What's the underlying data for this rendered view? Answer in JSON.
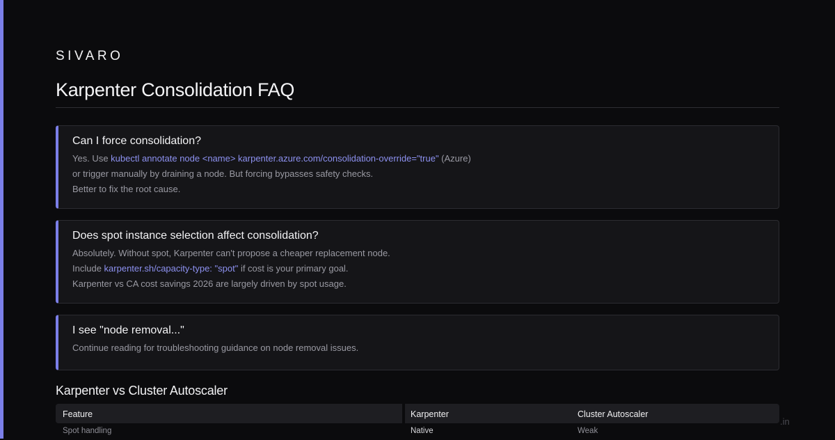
{
  "brand": "SIVARO",
  "page_title": "Karpenter Consolidation FAQ",
  "faq": [
    {
      "question": "Can I force consolidation?",
      "lines": [
        [
          {
            "text": "Yes. Use ",
            "code": false
          },
          {
            "text": "kubectl annotate node <name> karpenter.azure.com/consolidation-override=\"true\"",
            "code": true
          },
          {
            "text": " (Azure)",
            "code": false
          }
        ],
        [
          {
            "text": "or trigger manually by draining a node. But forcing bypasses safety checks.",
            "code": false
          }
        ],
        [
          {
            "text": "Better to fix the root cause.",
            "code": false
          }
        ]
      ]
    },
    {
      "question": "Does spot instance selection affect consolidation?",
      "lines": [
        [
          {
            "text": "Absolutely. Without spot, Karpenter can't propose a cheaper replacement node.",
            "code": false
          }
        ],
        [
          {
            "text": "Include ",
            "code": false
          },
          {
            "text": "karpenter.sh/capacity-type: \"spot\"",
            "code": true
          },
          {
            "text": " if cost is your primary goal.",
            "code": false
          }
        ],
        [
          {
            "text": "Karpenter vs CA cost savings 2026 are largely driven by spot usage.",
            "code": false
          }
        ]
      ]
    },
    {
      "question": "I see \"node removal...\"",
      "lines": [
        [
          {
            "text": "Continue reading for troubleshooting guidance on node removal issues.",
            "code": false
          }
        ]
      ]
    }
  ],
  "comparison": {
    "title": "Karpenter vs Cluster Autoscaler",
    "headers": [
      "Feature",
      "Karpenter",
      "Cluster Autoscaler"
    ],
    "rows": [
      [
        "Spot handling",
        "Native",
        "Weak"
      ]
    ]
  },
  "footer_hint": ".in",
  "colors": {
    "accent": "#7b7fe8",
    "code": "#8d91f0",
    "background": "#0b0b0d",
    "card": "#151518"
  }
}
